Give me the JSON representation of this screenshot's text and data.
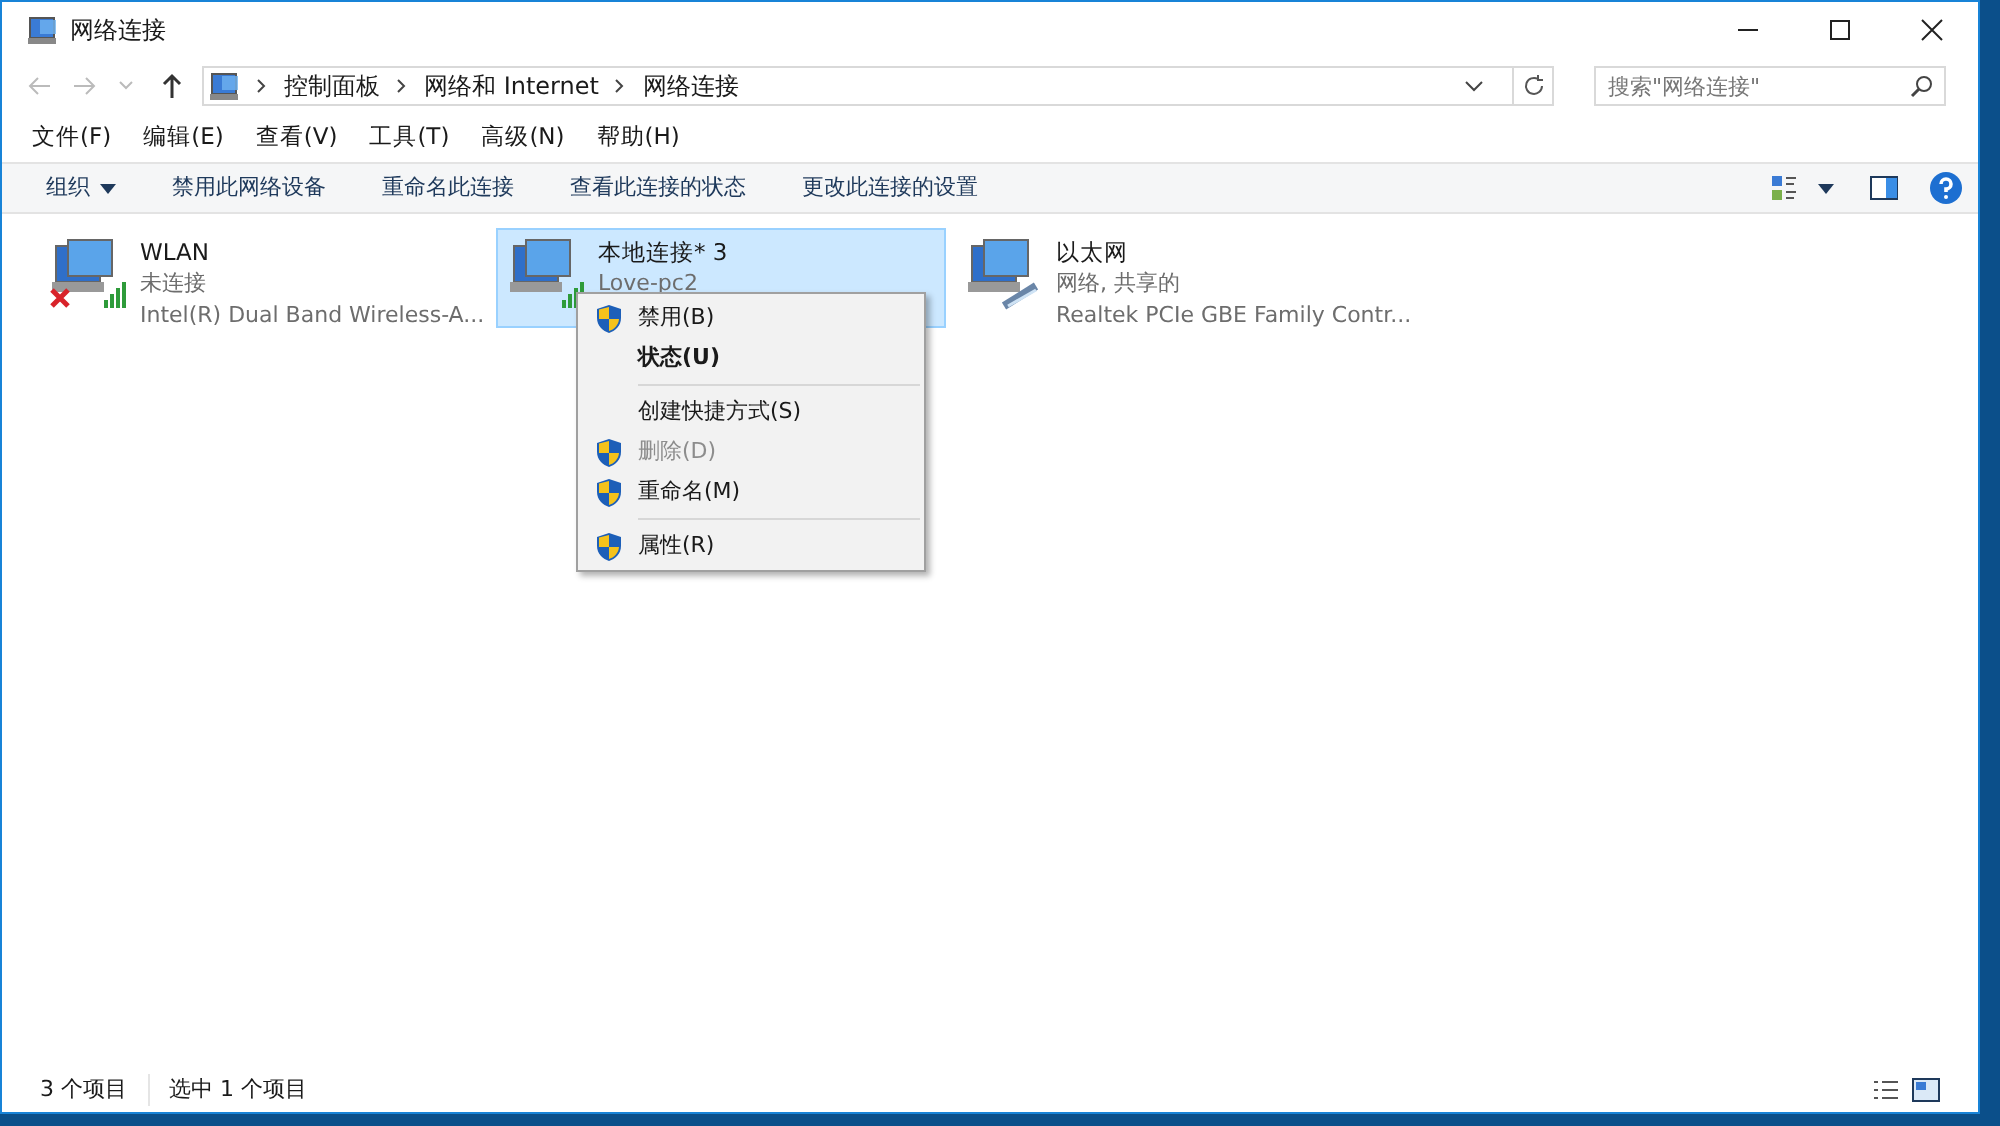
{
  "window": {
    "title": "网络连接"
  },
  "address_bar": {
    "crumbs": [
      "控制面板",
      "网络和 Internet",
      "网络连接"
    ]
  },
  "search": {
    "placeholder": "搜索\"网络连接\""
  },
  "menu_bar": [
    "文件(F)",
    "编辑(E)",
    "查看(V)",
    "工具(T)",
    "高级(N)",
    "帮助(H)"
  ],
  "command_bar": [
    {
      "label": "组织",
      "dropdown": true
    },
    {
      "label": "禁用此网络设备",
      "dropdown": false
    },
    {
      "label": "重命名此连接",
      "dropdown": false
    },
    {
      "label": "查看此连接的状态",
      "dropdown": false
    },
    {
      "label": "更改此连接的设置",
      "dropdown": false
    }
  ],
  "connections": [
    {
      "name": "WLAN",
      "status": "未连接",
      "device": "Intel(R) Dual Band Wireless-A...",
      "kind": "wireless",
      "disconnected": true,
      "selected": false
    },
    {
      "name": "本地连接* 3",
      "status": "Love-pc2",
      "kind": "wireless",
      "disconnected": false,
      "selected": true
    },
    {
      "name": "以太网",
      "status": "网络, 共享的",
      "device": "Realtek PCIe GBE Family Contr...",
      "kind": "ethernet",
      "disconnected": false,
      "selected": false
    }
  ],
  "context_menu": [
    {
      "kind": "item",
      "label": "禁用(B)",
      "shield": true,
      "default": false,
      "disabled": false
    },
    {
      "kind": "item",
      "label": "状态(U)",
      "shield": false,
      "default": true,
      "disabled": false
    },
    {
      "kind": "separator"
    },
    {
      "kind": "item",
      "label": "创建快捷方式(S)",
      "shield": false,
      "default": false,
      "disabled": false
    },
    {
      "kind": "item",
      "label": "删除(D)",
      "shield": true,
      "default": false,
      "disabled": true
    },
    {
      "kind": "item",
      "label": "重命名(M)",
      "shield": true,
      "default": false,
      "disabled": false
    },
    {
      "kind": "separator"
    },
    {
      "kind": "item",
      "label": "属性(R)",
      "shield": true,
      "default": false,
      "disabled": false
    }
  ],
  "status_bar": {
    "count": "3 个项目",
    "selection": "选中 1 个项目"
  }
}
